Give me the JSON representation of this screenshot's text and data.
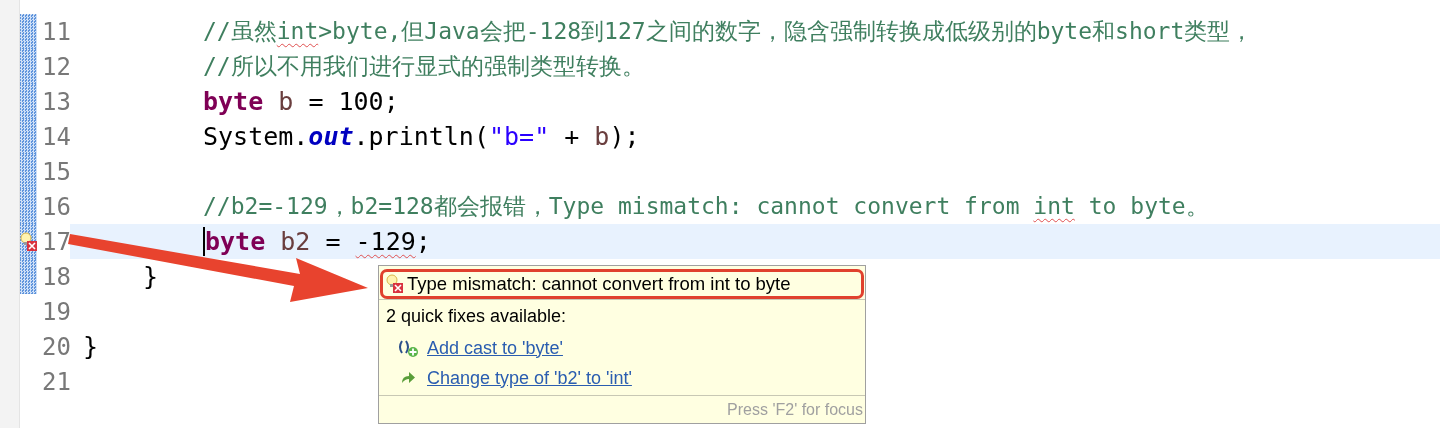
{
  "editor": {
    "lines": [
      {
        "number": "11",
        "changed": true,
        "current": false,
        "error": false,
        "kind": "body",
        "tokens": [
          {
            "text": "//虽然",
            "kind": "comment"
          },
          {
            "text": "int",
            "kind": "comment",
            "squiggle": true
          },
          {
            "text": ">byte,但Java会把-128到127之间的数字，隐含强制转换成低级别的byte和short类型，",
            "kind": "comment"
          }
        ]
      },
      {
        "number": "12",
        "changed": true,
        "current": false,
        "error": false,
        "kind": "body",
        "tokens": [
          {
            "text": "//所以不用我们进行显式的强制类型转换。",
            "kind": "comment"
          }
        ]
      },
      {
        "number": "13",
        "changed": true,
        "current": false,
        "error": false,
        "kind": "body",
        "tokens": [
          {
            "text": "byte",
            "kind": "keyword"
          },
          {
            "text": " b",
            "kind": "variable"
          },
          {
            "text": " = 100;",
            "kind": "plain"
          }
        ]
      },
      {
        "number": "14",
        "changed": true,
        "current": false,
        "error": false,
        "kind": "body",
        "tokens": [
          {
            "text": "System.",
            "kind": "plain"
          },
          {
            "text": "out",
            "kind": "field"
          },
          {
            "text": ".println(",
            "kind": "plain"
          },
          {
            "text": "\"b=\"",
            "kind": "string"
          },
          {
            "text": " + ",
            "kind": "plain"
          },
          {
            "text": "b",
            "kind": "variable"
          },
          {
            "text": ");",
            "kind": "plain"
          }
        ]
      },
      {
        "number": "15",
        "changed": true,
        "current": false,
        "error": false
      },
      {
        "number": "16",
        "changed": true,
        "current": false,
        "error": false,
        "kind": "body",
        "tokens": [
          {
            "text": "//b2=-129，b2=128都会报错，Type mismatch: cannot convert from ",
            "kind": "comment"
          },
          {
            "text": "int",
            "kind": "comment",
            "squiggle": true
          },
          {
            "text": " to byte。",
            "kind": "comment"
          }
        ]
      },
      {
        "number": "17",
        "changed": true,
        "current": true,
        "error": true,
        "kind": "body",
        "tokens": [
          {
            "text": "byte",
            "kind": "keyword"
          },
          {
            "text": " b2",
            "kind": "variable"
          },
          {
            "text": " = ",
            "kind": "plain"
          },
          {
            "text": "-129",
            "kind": "plain",
            "squiggle": true
          },
          {
            "text": ";",
            "kind": "plain"
          }
        ]
      },
      {
        "number": "18",
        "changed": true,
        "current": false,
        "error": false,
        "kind": "method",
        "tokens": [
          {
            "text": "}",
            "kind": "plain"
          }
        ]
      },
      {
        "number": "19",
        "changed": false,
        "current": false,
        "error": false
      },
      {
        "number": "20",
        "changed": false,
        "current": false,
        "error": false,
        "kind": "class",
        "tokens": [
          {
            "text": "}",
            "kind": "plain"
          }
        ]
      },
      {
        "number": "21",
        "changed": false,
        "current": false,
        "error": false
      }
    ]
  },
  "hover": {
    "message": "Type mismatch: cannot convert from int to byte",
    "fixes_title": "2 quick fixes available:",
    "fixes": [
      {
        "kind": "cast",
        "label": "Add cast to 'byte'"
      },
      {
        "kind": "change",
        "label": "Change type of 'b2' to 'int'"
      }
    ],
    "footer": "Press 'F2' for focus"
  }
}
